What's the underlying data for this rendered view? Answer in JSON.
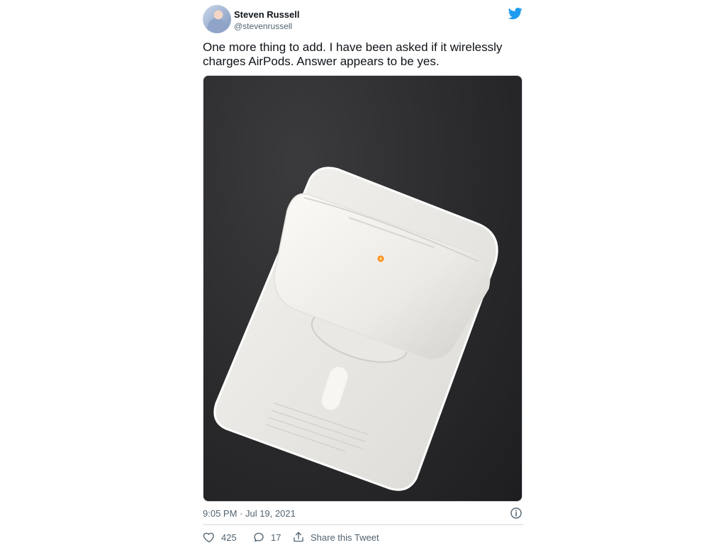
{
  "author": {
    "display_name": "Steven Russell",
    "handle": "@stevenrussell",
    "avatar_icon": "profile-photo"
  },
  "brand": {
    "icon": "twitter-bird-icon",
    "color": "#1d9bf0"
  },
  "tweet": {
    "text": "One more thing to add. I have been asked if it wirelessly charges AirPods. Answer appears to be yes.",
    "timestamp": "9:05 PM · Jul 19, 2021"
  },
  "actions": {
    "likes": "425",
    "replies": "17",
    "share_label": "Share this Tweet"
  },
  "colors": {
    "text": "#0f1419",
    "secondary": "#536471",
    "border": "#cfd9de"
  }
}
